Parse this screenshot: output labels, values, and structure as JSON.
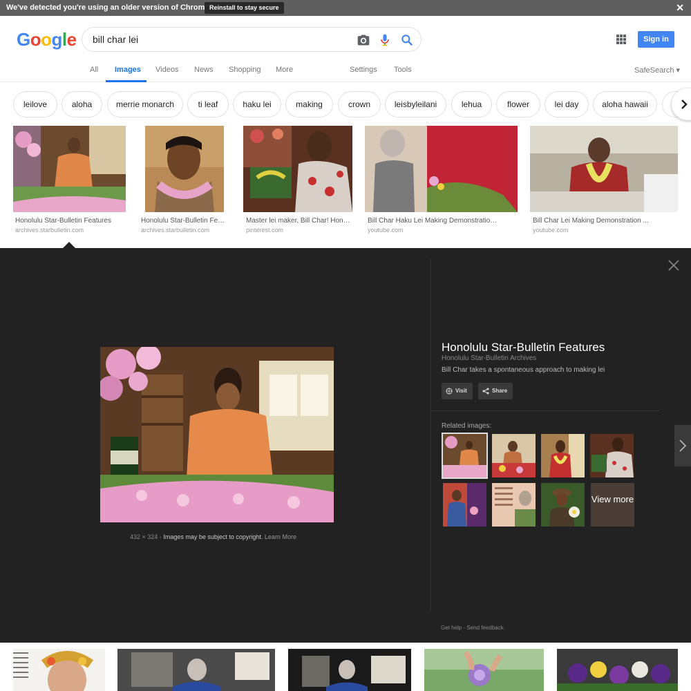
{
  "banner": {
    "message": "We've detected you're using an older version of Chrome.",
    "button": "Reinstall to stay secure",
    "close": "✕"
  },
  "header": {
    "logo": [
      "G",
      "o",
      "o",
      "g",
      "l",
      "e"
    ],
    "query": "bill char lei",
    "signin": "Sign in"
  },
  "tabs": {
    "items": [
      "All",
      "Images",
      "Videos",
      "News",
      "Shopping",
      "More"
    ],
    "active": "Images",
    "settings": "Settings",
    "tools": "Tools",
    "safesearch": "SafeSearch ▾"
  },
  "chips": [
    "leilove",
    "aloha",
    "merrie monarch",
    "ti leaf",
    "haku lei",
    "making",
    "crown",
    "leisbyleilani",
    "lehua",
    "flower",
    "lei day",
    "aloha hawaii"
  ],
  "results": [
    {
      "title": "Honolulu Star-Bulletin Features",
      "source": "archives.starbulletin.com"
    },
    {
      "title": "Honolulu Star-Bulletin Feat...",
      "source": "archives.starbulletin.com"
    },
    {
      "title": "Master lei maker, Bill Char! Honol...",
      "source": "pinterest.com"
    },
    {
      "title": "Bill Char Haku Lei Making Demonstration ...",
      "source": "youtube.com"
    },
    {
      "title": "Bill Char Lei Making Demonstration ...",
      "source": "youtube.com"
    }
  ],
  "panel": {
    "title": "Honolulu Star-Bulletin Features",
    "site": "Honolulu Star-Bulletin Archives",
    "description": "Bill Char takes a spontaneous approach to making lei",
    "visit": "Visit",
    "share": "Share",
    "dimensions": "432 × 324",
    "separator": "-",
    "copyright": "Images may be subject to copyright.",
    "learn_more": "Learn More",
    "related_label": "Related images:",
    "view_more": "View more",
    "get_help": "Get help",
    "send_feedback": "Send feedback"
  },
  "colors": {
    "accent": "#1a73e8",
    "signin": "#4285f4",
    "panel_bg": "#222222",
    "banner_bg": "#5f5f5f"
  }
}
